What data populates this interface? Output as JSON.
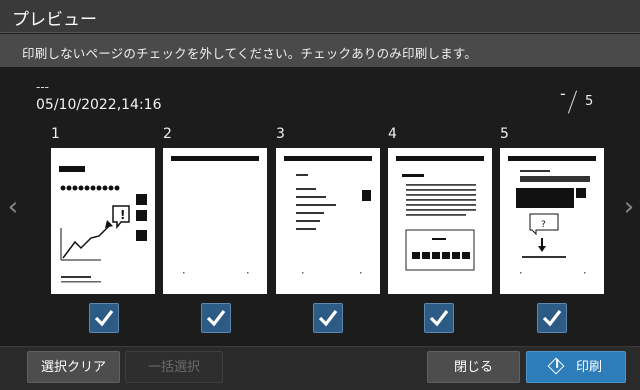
{
  "window": {
    "title": "プレビュー"
  },
  "instruction": "印刷しないページのチェックを外してください。チェックありのみ印刷します。",
  "document": {
    "name": "---",
    "datetime": "05/10/2022,14:16"
  },
  "page_counter": {
    "current": "-",
    "total": "5"
  },
  "pages": [
    {
      "label": "1",
      "checked": true
    },
    {
      "label": "2",
      "checked": true
    },
    {
      "label": "3",
      "checked": true
    },
    {
      "label": "4",
      "checked": true
    },
    {
      "label": "5",
      "checked": true
    }
  ],
  "nav": {
    "left_icon": "chevron-left-icon",
    "right_icon": "chevron-right-icon"
  },
  "buttons": {
    "clear_selection": "選択クリア",
    "select_all": "一括選択",
    "close": "閉じる",
    "print": "印刷"
  },
  "colors": {
    "accent": "#2e7dbb",
    "checkbox": "#2c5b86",
    "title_bar": "#3a3a3a"
  }
}
